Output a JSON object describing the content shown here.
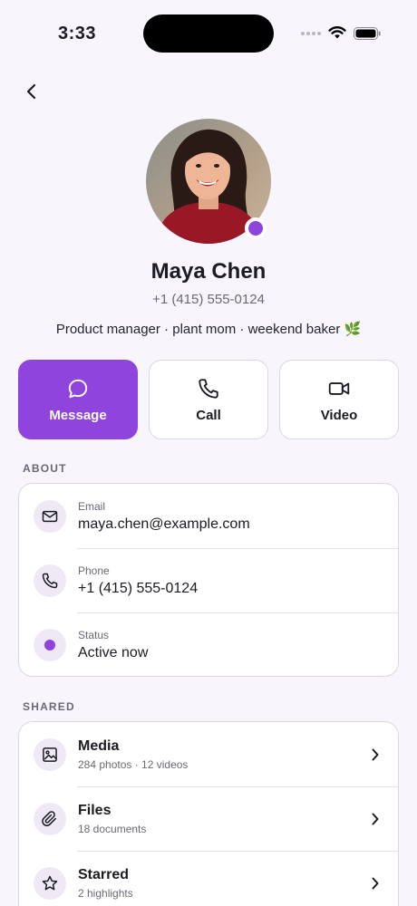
{
  "status_bar": {
    "time": "3:33"
  },
  "contact": {
    "name": "Maya Chen",
    "phone": "+1 (415) 555-0124",
    "bio": "Product manager · plant mom · weekend baker 🌿"
  },
  "actions": [
    {
      "label": "Message",
      "icon": "message-icon"
    },
    {
      "label": "Call",
      "icon": "phone-icon"
    },
    {
      "label": "Video",
      "icon": "video-icon"
    }
  ],
  "about": {
    "title": "ABOUT",
    "rows": [
      {
        "label": "Email",
        "value": "maya.chen@example.com",
        "icon": "mail-icon"
      },
      {
        "label": "Phone",
        "value": "+1 (415) 555-0124",
        "icon": "phone-icon"
      },
      {
        "label": "Status",
        "value": "Active now",
        "icon": "status-dot-icon"
      }
    ]
  },
  "shared": {
    "title": "SHARED",
    "rows": [
      {
        "title": "Media",
        "detail": "284 photos · 12 videos",
        "icon": "image-icon"
      },
      {
        "title": "Files",
        "detail": "18 documents",
        "icon": "paperclip-icon"
      },
      {
        "title": "Starred",
        "detail": "2 highlights",
        "icon": "star-icon"
      }
    ]
  },
  "colors": {
    "accent": "#8e44dd",
    "background": "#f8f5fd"
  }
}
